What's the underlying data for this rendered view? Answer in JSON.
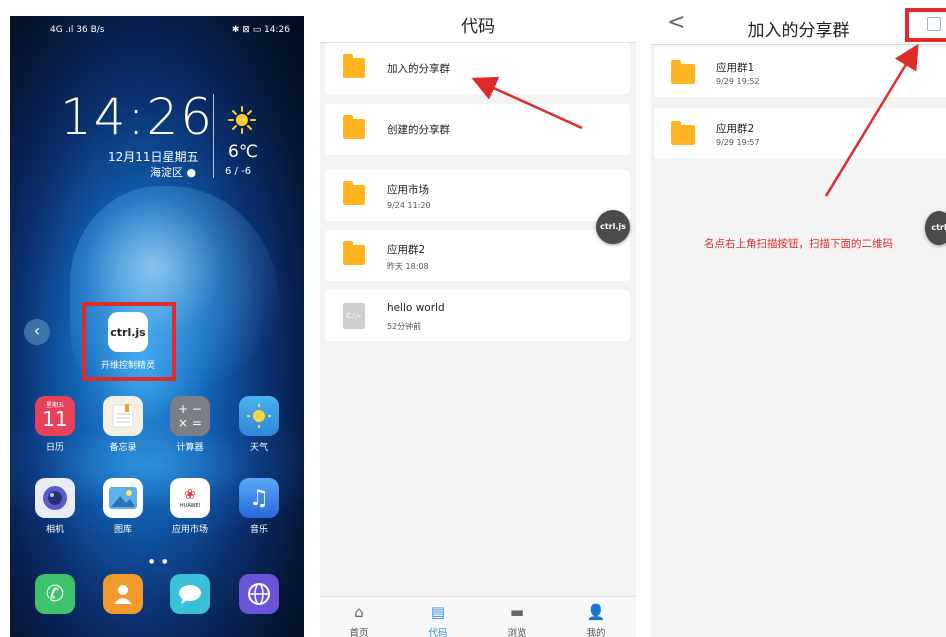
{
  "home": {
    "status_left": "4G .ıl 36 B/s",
    "status_right": "✱ ⊠ ▭ 14:26",
    "clock": "14:26",
    "date": "12月11日星期五",
    "location": "海淀区",
    "temperature": "6℃",
    "temp_range": "6 / -6",
    "ctrl_icon_text": "ctrl.js",
    "ctrl_app_label": "开维控制精灵",
    "calendar_weekday": "星期五",
    "calendar_day": "11",
    "apps": [
      {
        "label": "日历",
        "icon": "calendar-icon"
      },
      {
        "label": "备忘录",
        "icon": "notes-icon"
      },
      {
        "label": "计算器",
        "icon": "calculator-icon"
      },
      {
        "label": "天气",
        "icon": "weather-icon"
      },
      {
        "label": "相机",
        "icon": "camera-icon"
      },
      {
        "label": "图库",
        "icon": "gallery-icon"
      },
      {
        "label": "应用市场",
        "icon": "app-market-icon"
      },
      {
        "label": "音乐",
        "icon": "music-icon"
      }
    ],
    "huawei_text": "HUAWEI",
    "dock": [
      "phone-icon",
      "contacts-icon",
      "messages-icon",
      "browser-icon"
    ]
  },
  "code": {
    "title": "代码",
    "items": [
      {
        "title": "加入的分享群",
        "sub": ""
      },
      {
        "title": "创建的分享群",
        "sub": ""
      },
      {
        "title": "应用市场",
        "sub": "9/24 11:20"
      },
      {
        "title": "应用群2",
        "sub": "昨天 18:08"
      },
      {
        "title": "hello world",
        "sub": "52分钟前"
      }
    ],
    "float_label": "ctrl.js",
    "tabs": [
      {
        "label": "首页",
        "icon": "home-icon"
      },
      {
        "label": "代码",
        "icon": "code-icon"
      },
      {
        "label": "浏览",
        "icon": "browse-icon"
      },
      {
        "label": "我的",
        "icon": "profile-icon"
      }
    ]
  },
  "joined": {
    "back": "<",
    "title": "加入的分享群",
    "items": [
      {
        "title": "应用群1",
        "sub": "9/29 19:52"
      },
      {
        "title": "应用群2",
        "sub": "9/29 19:57"
      }
    ],
    "annotation": "名点右上角扫描按钮，扫描下面的二维码",
    "float_label": "ctrl"
  },
  "colors": {
    "accent": "#3a8ee6",
    "highlight": "#e02b2b",
    "folder": "#ffb521"
  }
}
